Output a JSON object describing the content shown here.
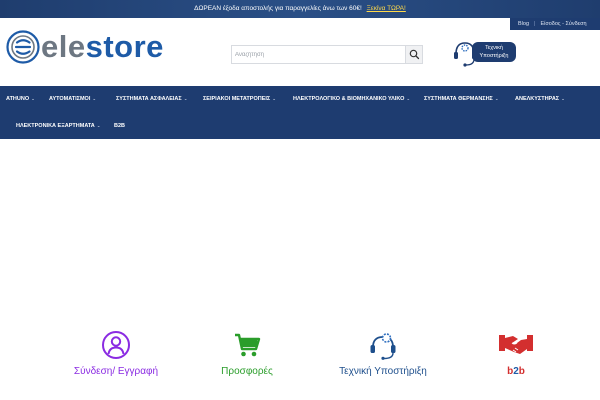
{
  "promo": {
    "text": "ΔΩΡΕΑΝ έξοδα αποστολής για παραγγελίες άνω των 60€!",
    "cta": "Ξεκίνα ΤΩΡΑ!"
  },
  "top_links": {
    "blog": "Blog",
    "login": "Είσοδος - Σύνδεση"
  },
  "logo": {
    "part1": "ele",
    "part2": "store"
  },
  "search": {
    "placeholder": "Αναζήτηση",
    "value": ""
  },
  "support": {
    "label": "Τεχνική Υποστήριξη"
  },
  "nav": {
    "row1": [
      {
        "label": "ATHUNO",
        "has_dropdown": true
      },
      {
        "label": "ΑΥΤΟΜΑΤΙΣΜΟΙ",
        "has_dropdown": true
      },
      {
        "label": "ΣΥΣΤΗΜΑΤΑ ΑΣΦΑΛΕΙΑΣ",
        "has_dropdown": true
      },
      {
        "label": "ΣΕΙΡΙΑΚΟΙ ΜΕΤΑΤΡΟΠΕΙΣ",
        "has_dropdown": true
      },
      {
        "label": "ΗΛΕΚΤΡΟΛΟΓΙΚΟ & ΒΙΟΜΗΧΑΝΙΚΟ ΥΛΙΚΟ",
        "has_dropdown": true
      },
      {
        "label": "ΣΥΣΤΗΜΑΤΑ ΘΕΡΜΑΝΣΗΣ",
        "has_dropdown": true
      },
      {
        "label": "ΑΝΕΛΚΥΣΤΗΡΑΣ",
        "has_dropdown": true
      }
    ],
    "row2": [
      {
        "label": "ΗΛΕΚΤΡΟΝΙΚΑ ΕΞΑΡΤΗΜΑΤΑ",
        "has_dropdown": true
      },
      {
        "label": "B2B",
        "has_dropdown": false
      }
    ],
    "caret": "⌄"
  },
  "features": [
    {
      "label": "Σύνδεση/ Εγγραφή",
      "icon": "user-circle-icon",
      "color": "#8a2be2"
    },
    {
      "label": "Προσφορές",
      "icon": "shopping-cart-icon",
      "color": "#2a9d2a"
    },
    {
      "label": "Τεχνική Υποστήριξη",
      "icon": "support-headset-icon",
      "color": "#1e4f8c"
    },
    {
      "label": "b2b",
      "label_colored_char": "2",
      "icon": "handshake-icon",
      "color": "#d32f2f"
    }
  ],
  "colors": {
    "brand_blue": "#1e3c70",
    "logo_gray": "#6d7782",
    "logo_blue": "#1e5ba7",
    "promo_cta": "#ffd84a"
  }
}
